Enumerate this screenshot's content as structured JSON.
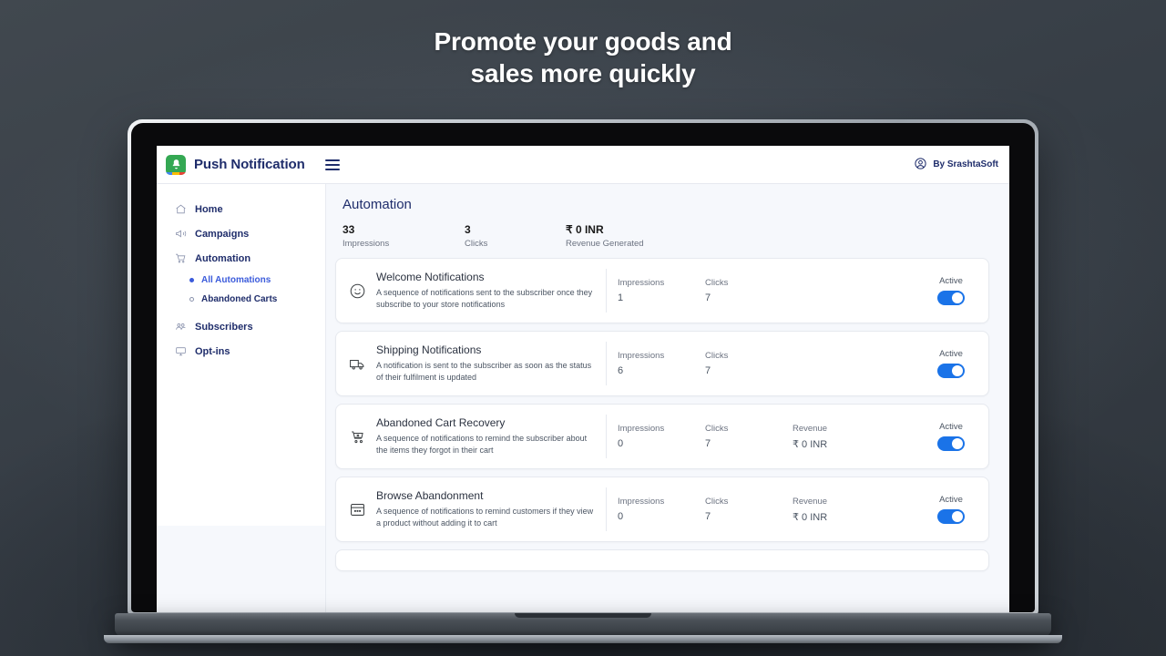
{
  "promo": {
    "headline_line1": "Promote your goods and",
    "headline_line2": "sales more quickly"
  },
  "colors": {
    "accent_blue": "#1a73e8",
    "brand_green": "#34a853",
    "navy": "#1f2d6b",
    "link_blue": "#3b5bdb"
  },
  "header": {
    "app_title": "Push Notification",
    "logo_icon": "bell-icon",
    "menu_icon": "hamburger-menu-icon",
    "account_icon": "user-circle-icon",
    "account_label": "By SrashtaSoft"
  },
  "sidebar": {
    "items": [
      {
        "label": "Home",
        "icon": "home-icon"
      },
      {
        "label": "Campaigns",
        "icon": "megaphone-icon"
      },
      {
        "label": "Automation",
        "icon": "shopping-cart-icon"
      }
    ],
    "subitems": [
      {
        "label": "All Automations",
        "active": true
      },
      {
        "label": "Abandoned Carts",
        "active": false
      }
    ],
    "items_after": [
      {
        "label": "Subscribers",
        "icon": "users-icon"
      },
      {
        "label": "Opt-ins",
        "icon": "monitor-icon"
      }
    ]
  },
  "main": {
    "page_title": "Automation",
    "stats": [
      {
        "value": "33",
        "label": "Impressions"
      },
      {
        "value": "3",
        "label": "Clicks"
      },
      {
        "value": "₹ 0 INR",
        "label": "Revenue Generated"
      }
    ],
    "cards": [
      {
        "icon": "smiley-face-icon",
        "title": "Welcome Notifications",
        "description": "A sequence of notifications sent to the subscriber once they subscribe to your store notifications",
        "metrics": [
          {
            "label": "Impressions",
            "value": "1"
          },
          {
            "label": "Clicks",
            "value": "7"
          }
        ],
        "toggle_label": "Active",
        "toggle_on": true
      },
      {
        "icon": "delivery-truck-icon",
        "title": "Shipping Notifications",
        "description": "A notification is sent to the subscriber as soon as the status of their fulfilment is updated",
        "metrics": [
          {
            "label": "Impressions",
            "value": "6"
          },
          {
            "label": "Clicks",
            "value": "7"
          }
        ],
        "toggle_label": "Active",
        "toggle_on": true
      },
      {
        "icon": "abandoned-cart-icon",
        "title": "Abandoned Cart Recovery",
        "description": "A sequence of notifications to remind the subscriber about the items they forgot in their cart",
        "metrics": [
          {
            "label": "Impressions",
            "value": "0"
          },
          {
            "label": "Clicks",
            "value": "7"
          },
          {
            "label": "Revenue",
            "value": "₹ 0 INR"
          }
        ],
        "toggle_label": "Active",
        "toggle_on": true
      },
      {
        "icon": "storefront-window-icon",
        "title": "Browse Abandonment",
        "description": "A sequence of notifications to remind customers if they view a product without adding it to cart",
        "metrics": [
          {
            "label": "Impressions",
            "value": "0"
          },
          {
            "label": "Clicks",
            "value": "7"
          },
          {
            "label": "Revenue",
            "value": "₹ 0 INR"
          }
        ],
        "toggle_label": "Active",
        "toggle_on": true
      }
    ]
  }
}
